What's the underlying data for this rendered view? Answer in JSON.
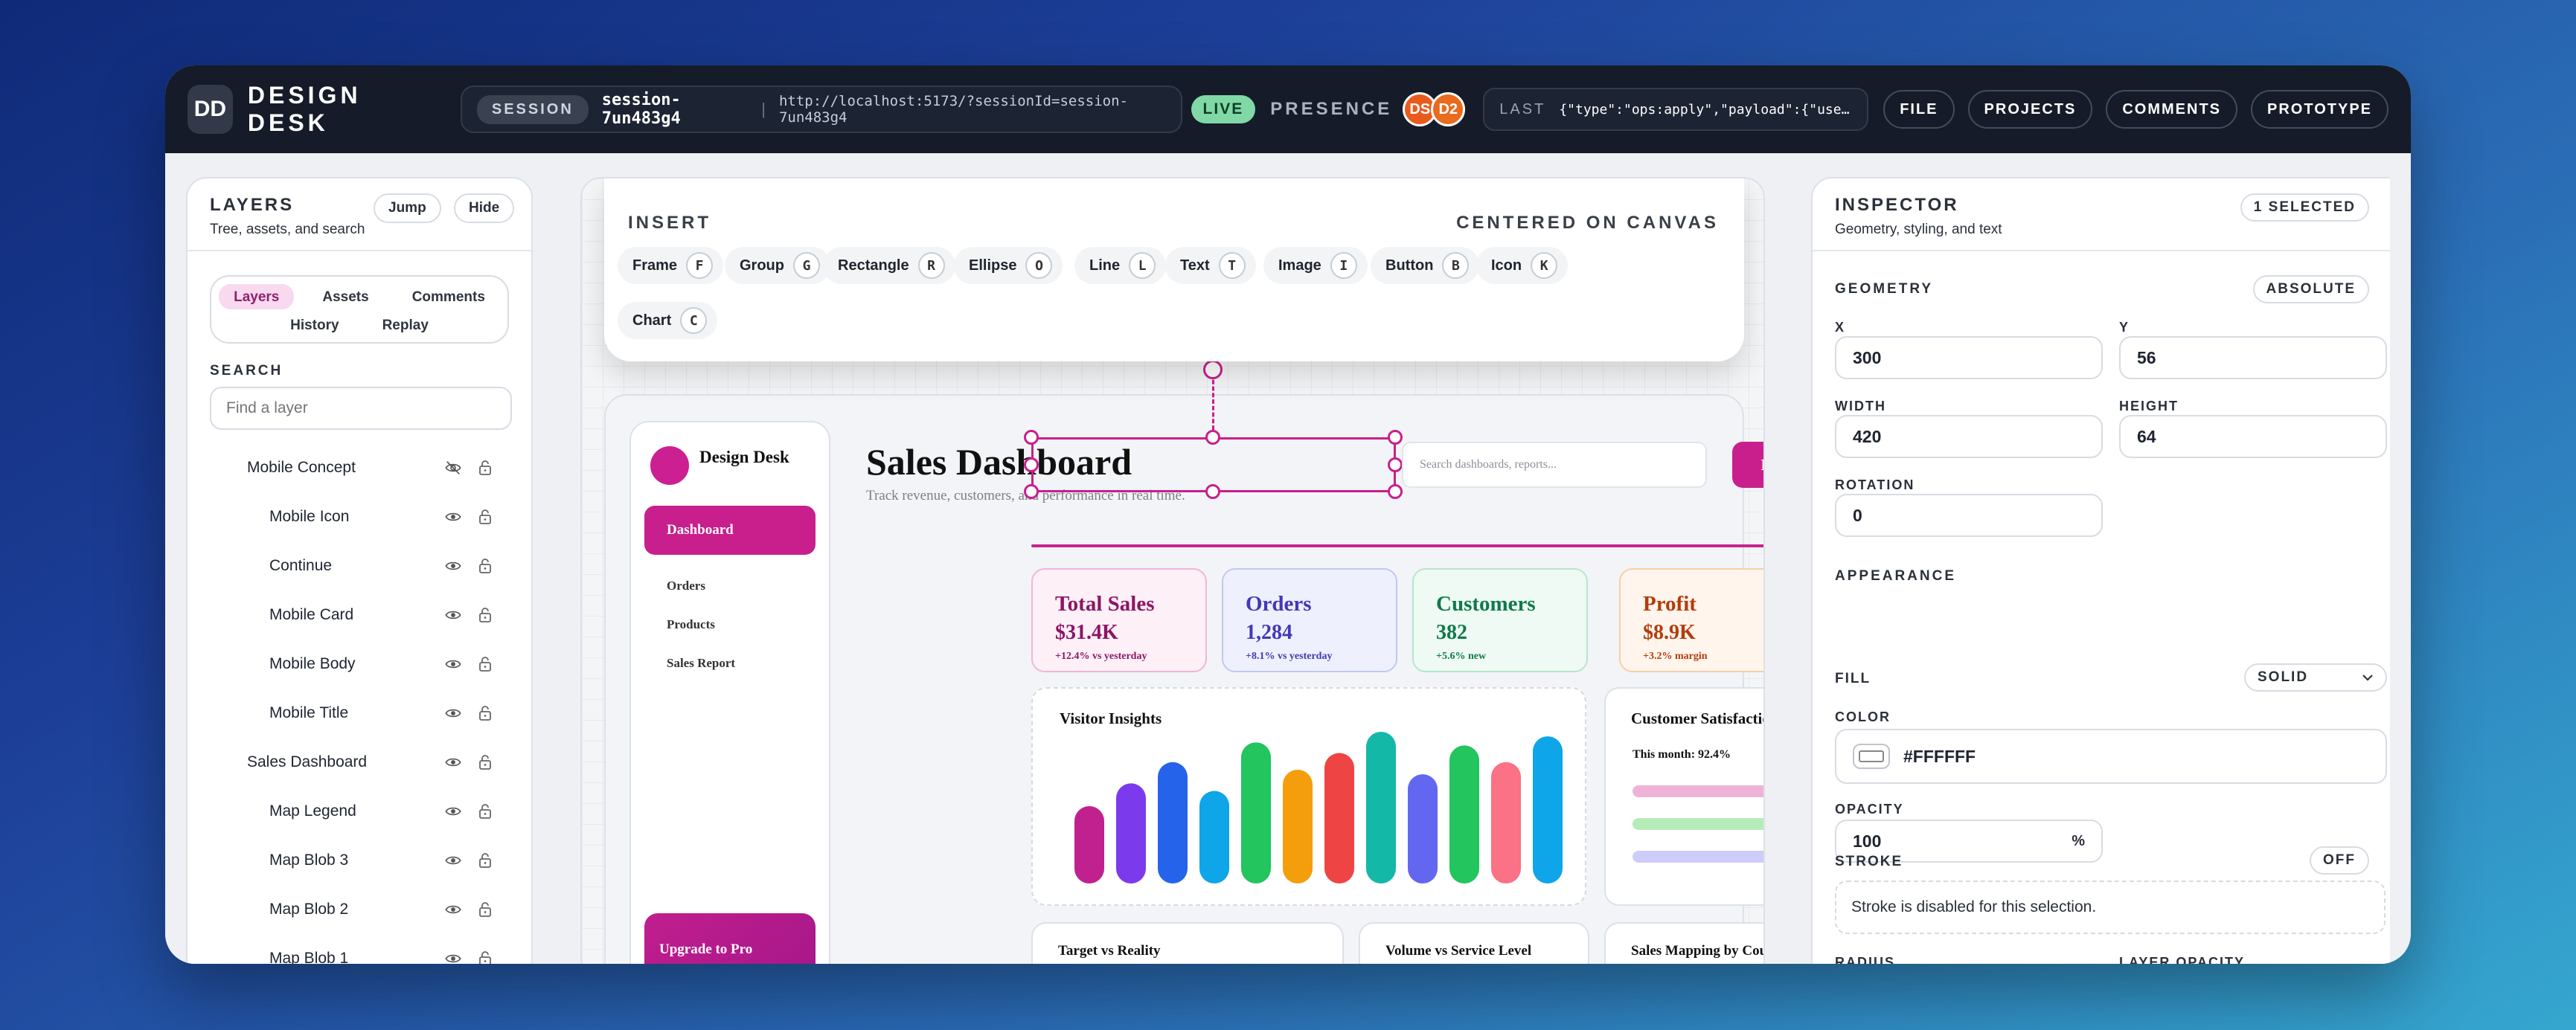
{
  "app": {
    "logo": "DD",
    "name": "DESIGN DESK"
  },
  "session": {
    "tag": "SESSION",
    "id": "session-7un483g4",
    "url": "http://localhost:5173/?sessionId=session-7un483g4",
    "status": "LIVE"
  },
  "presence": {
    "label": "PRESENCE",
    "avatars": [
      "DS",
      "D2"
    ]
  },
  "last_event": {
    "label": "LAST",
    "value": "{\"type\":\"ops:apply\",\"payload\":{\"userId\"…"
  },
  "nav": [
    "FILE",
    "PROJECTS",
    "COMMENTS",
    "PROTOTYPE"
  ],
  "layers_panel": {
    "title": "LAYERS",
    "subtitle": "Tree, assets, and search",
    "jump_label": "Jump",
    "hide_label": "Hide",
    "tabs": [
      "Layers",
      "Assets",
      "Comments",
      "History",
      "Replay"
    ],
    "active_tab": "Layers",
    "search_label": "SEARCH",
    "search_placeholder": "Find a layer",
    "layers": [
      {
        "name": "Mobile Concept",
        "level": 1,
        "hidden": true
      },
      {
        "name": "Mobile Icon",
        "level": 2,
        "hidden": false
      },
      {
        "name": "Continue",
        "level": 2,
        "hidden": false
      },
      {
        "name": "Mobile Card",
        "level": 2,
        "hidden": false
      },
      {
        "name": "Mobile Body",
        "level": 2,
        "hidden": false
      },
      {
        "name": "Mobile Title",
        "level": 2,
        "hidden": false
      },
      {
        "name": "Sales Dashboard",
        "level": 1,
        "hidden": false
      },
      {
        "name": "Map Legend",
        "level": 2,
        "hidden": false
      },
      {
        "name": "Map Blob 3",
        "level": 2,
        "hidden": false
      },
      {
        "name": "Map Blob 2",
        "level": 2,
        "hidden": false
      },
      {
        "name": "Map Blob 1",
        "level": 2,
        "hidden": false
      }
    ]
  },
  "insert": {
    "title": "INSERT",
    "hint": "CENTERED ON CANVAS",
    "tools": [
      {
        "label": "Frame",
        "key": "F"
      },
      {
        "label": "Group",
        "key": "G"
      },
      {
        "label": "Rectangle",
        "key": "R"
      },
      {
        "label": "Ellipse",
        "key": "O"
      },
      {
        "label": "Line",
        "key": "L"
      },
      {
        "label": "Text",
        "key": "T"
      },
      {
        "label": "Image",
        "key": "I"
      },
      {
        "label": "Button",
        "key": "B"
      },
      {
        "label": "Icon",
        "key": "K"
      },
      {
        "label": "Chart",
        "key": "C"
      }
    ]
  },
  "dashboard": {
    "brand": "Design Desk",
    "nav_active": "Dashboard",
    "nav": [
      "Orders",
      "Products",
      "Sales Report"
    ],
    "upgrade": "Upgrade to Pro",
    "title": "Sales Dashboard",
    "subtitle": "Track revenue, customers, and performance in real time.",
    "search_placeholder": "Search dashboards, reports...",
    "export_label": "Export",
    "stats": [
      {
        "label": "Total Sales",
        "value": "$31.4K",
        "delta": "+12.4% vs yesterday",
        "color": "#8e1467",
        "bg": "#fdf0f6",
        "border": "#f0b6d6"
      },
      {
        "label": "Orders",
        "value": "1,284",
        "delta": "+8.1% vs yesterday",
        "color": "#4337b8",
        "bg": "#eef0fd",
        "border": "#c2c7f3"
      },
      {
        "label": "Customers",
        "value": "382",
        "delta": "+5.6% new",
        "color": "#0f7a4a",
        "bg": "#eefaf3",
        "border": "#b6e6cc"
      },
      {
        "label": "Profit",
        "value": "$8.9K",
        "delta": "+3.2% margin",
        "color": "#b43c0d",
        "bg": "#fff5ec",
        "border": "#f6cfa9"
      }
    ],
    "visitor_title": "Visitor Insights",
    "visitor_bars": [
      {
        "value": 0.51,
        "color": "#c0218e"
      },
      {
        "value": 0.66,
        "color": "#7c3aed"
      },
      {
        "value": 0.8,
        "color": "#2563eb"
      },
      {
        "value": 0.61,
        "color": "#0ea5e9"
      },
      {
        "value": 0.93,
        "color": "#22c55e"
      },
      {
        "value": 0.75,
        "color": "#f59e0b"
      },
      {
        "value": 0.86,
        "color": "#ef4444"
      },
      {
        "value": 1.0,
        "color": "#14b8a6"
      },
      {
        "value": 0.72,
        "color": "#6366f1"
      },
      {
        "value": 0.91,
        "color": "#22c55e"
      },
      {
        "value": 0.8,
        "color": "#fb7185"
      },
      {
        "value": 0.97,
        "color": "#0ea5e9"
      }
    ],
    "satisfaction_title": "Customer Satisfaction",
    "satisfaction_note": "This month: 92.4%",
    "satisfaction_bars": [
      {
        "value": 0.78,
        "color": "#f0b3d8"
      },
      {
        "value": 0.73,
        "color": "#b6ecb9"
      },
      {
        "value": 0.86,
        "color": "#cdccfb"
      }
    ],
    "bottom_cards": [
      "Target vs Reality",
      "Volume vs Service Level",
      "Sales Mapping by Country"
    ]
  },
  "inspector": {
    "title": "INSPECTOR",
    "subtitle": "Geometry, styling, and text",
    "selection": "1 SELECTED",
    "geometry_label": "GEOMETRY",
    "position_mode": "ABSOLUTE",
    "x_label": "X",
    "x": "300",
    "y_label": "Y",
    "y": "56",
    "width_label": "WIDTH",
    "width": "420",
    "height_label": "HEIGHT",
    "height": "64",
    "rotation_label": "ROTATION",
    "rotation": "0",
    "appearance_label": "APPEARANCE",
    "fill_label": "FILL",
    "fill_mode": "SOLID",
    "color_label": "COLOR",
    "color": "#FFFFFF",
    "opacity_label": "OPACITY",
    "opacity": "100",
    "opacity_unit": "%",
    "stroke_label": "STROKE",
    "stroke_state": "OFF",
    "stroke_note": "Stroke is disabled for this selection.",
    "radius_label": "RADIUS",
    "layer_opacity_label": "LAYER OPACITY"
  },
  "colors": {
    "accent": "#C81F8D",
    "topbar": "#151B28",
    "live": "#7FD8A6"
  }
}
